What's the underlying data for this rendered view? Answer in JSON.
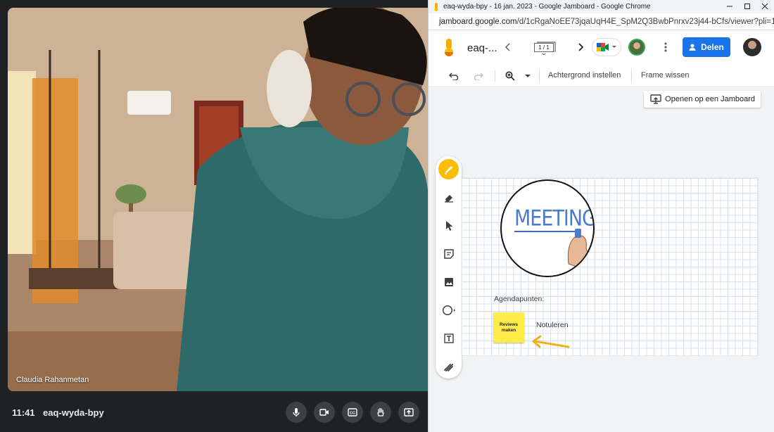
{
  "meet": {
    "participant_name": "Claudia Rahanmetan",
    "clock": "11:41",
    "meeting_code": "eaq-wyda-bpy"
  },
  "browser": {
    "window_title": "eaq-wyda-bpy - 16 jan. 2023 - Google Jamboard - Google Chrome",
    "url_host": "jamboard.google.com",
    "url_path": "/d/1cRgaNoEE73jqaUqH4E_SpM2Q3BwbPnrxv23j44-bCfs/viewer?pli=1..."
  },
  "jamboard": {
    "title": "eaq-...",
    "frame_indicator": "1 / 1",
    "share_label": "Delen",
    "toolbar": {
      "background_label": "Achtergrond instellen",
      "clear_frame_label": "Frame wissen"
    },
    "open_button_label": "Openen op een Jamboard",
    "canvas": {
      "meeting_word": "MEETING",
      "agenda_label": "Agendapunten:",
      "sticky_note": "Reviews maken",
      "notes_label": "Notuleren"
    }
  },
  "colors": {
    "accent": "#1a73e8",
    "active_tool": "#fbbc04",
    "sticky": "#fdeb47",
    "arrow": "#f2b01e"
  }
}
